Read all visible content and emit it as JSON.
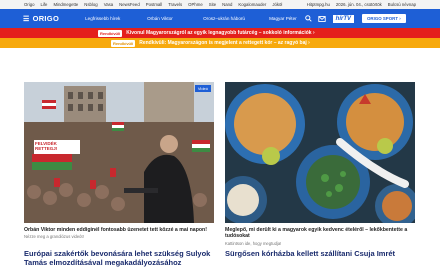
{
  "topstrip": {
    "links": [
      "Origo",
      "Life",
      "Mindmegette",
      "Nsblog",
      "Vasa",
      "NewsFeed",
      "Postmall",
      "Travels",
      "OPhme",
      "Site",
      "Nand",
      "Kogalomauder",
      "Jóköl"
    ],
    "right_link": "Hitptmpg.hu",
    "date": "2026. jún. 04., csütörtök",
    "nameday": "Bulcsú névnap"
  },
  "header": {
    "logo_text": "ORIGO",
    "nav": [
      "Legfrissebb hírek",
      "Orbán Viktor",
      "Orosz–ukrán háború",
      "Magyar Péter"
    ],
    "hirtv_label": "hírTV",
    "sport_label": "ORIGO SPORT ›"
  },
  "alerts": {
    "red_badge": "Rendkívüli",
    "red_text": "Kivonul Magyarországról az egyik legnagyobb futárcég – sokkoló információk ›",
    "yellow_badge": "Rendkívüli",
    "yellow_text": "Rendkívüli: Magyarországon is megjelent a rettegett kór – az ragyó baj ›"
  },
  "cards": [
    {
      "video_label": "Videó",
      "caption": "Orbán Viktor minden eddiginél fontosabb üzenetet tett közzé a mai napon!",
      "sub": "Nézze meg a grandiózus videót!",
      "banner_text": "FELVIDÉK RETTEGJ!"
    },
    {
      "caption": "Meglepő, mi derült ki a magyarok egyik kedvenc ételéről – lekőkbentette a tudósokat",
      "sub": "Kattintson ide, hogy megtudja!"
    }
  ],
  "next": {
    "left_title": "Európai szakértők bevonására lehet szükség Sulyok Tamás elmozdításával megakadályozásához",
    "right_title": "Sürgősen kórházba kellett szállítani Csuja Imrét"
  },
  "colors": {
    "brand": "#1e5fd6",
    "alert_red": "#e4201c",
    "alert_yellow": "#f7a90d"
  }
}
